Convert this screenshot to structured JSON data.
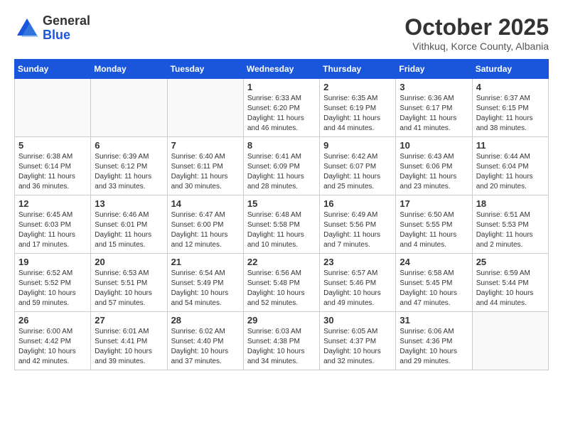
{
  "logo": {
    "general": "General",
    "blue": "Blue"
  },
  "title": "October 2025",
  "subtitle": "Vithkuq, Korce County, Albania",
  "headers": [
    "Sunday",
    "Monday",
    "Tuesday",
    "Wednesday",
    "Thursday",
    "Friday",
    "Saturday"
  ],
  "weeks": [
    [
      {
        "day": "",
        "info": ""
      },
      {
        "day": "",
        "info": ""
      },
      {
        "day": "",
        "info": ""
      },
      {
        "day": "1",
        "info": "Sunrise: 6:33 AM\nSunset: 6:20 PM\nDaylight: 11 hours\nand 46 minutes."
      },
      {
        "day": "2",
        "info": "Sunrise: 6:35 AM\nSunset: 6:19 PM\nDaylight: 11 hours\nand 44 minutes."
      },
      {
        "day": "3",
        "info": "Sunrise: 6:36 AM\nSunset: 6:17 PM\nDaylight: 11 hours\nand 41 minutes."
      },
      {
        "day": "4",
        "info": "Sunrise: 6:37 AM\nSunset: 6:15 PM\nDaylight: 11 hours\nand 38 minutes."
      }
    ],
    [
      {
        "day": "5",
        "info": "Sunrise: 6:38 AM\nSunset: 6:14 PM\nDaylight: 11 hours\nand 36 minutes."
      },
      {
        "day": "6",
        "info": "Sunrise: 6:39 AM\nSunset: 6:12 PM\nDaylight: 11 hours\nand 33 minutes."
      },
      {
        "day": "7",
        "info": "Sunrise: 6:40 AM\nSunset: 6:11 PM\nDaylight: 11 hours\nand 30 minutes."
      },
      {
        "day": "8",
        "info": "Sunrise: 6:41 AM\nSunset: 6:09 PM\nDaylight: 11 hours\nand 28 minutes."
      },
      {
        "day": "9",
        "info": "Sunrise: 6:42 AM\nSunset: 6:07 PM\nDaylight: 11 hours\nand 25 minutes."
      },
      {
        "day": "10",
        "info": "Sunrise: 6:43 AM\nSunset: 6:06 PM\nDaylight: 11 hours\nand 23 minutes."
      },
      {
        "day": "11",
        "info": "Sunrise: 6:44 AM\nSunset: 6:04 PM\nDaylight: 11 hours\nand 20 minutes."
      }
    ],
    [
      {
        "day": "12",
        "info": "Sunrise: 6:45 AM\nSunset: 6:03 PM\nDaylight: 11 hours\nand 17 minutes."
      },
      {
        "day": "13",
        "info": "Sunrise: 6:46 AM\nSunset: 6:01 PM\nDaylight: 11 hours\nand 15 minutes."
      },
      {
        "day": "14",
        "info": "Sunrise: 6:47 AM\nSunset: 6:00 PM\nDaylight: 11 hours\nand 12 minutes."
      },
      {
        "day": "15",
        "info": "Sunrise: 6:48 AM\nSunset: 5:58 PM\nDaylight: 11 hours\nand 10 minutes."
      },
      {
        "day": "16",
        "info": "Sunrise: 6:49 AM\nSunset: 5:56 PM\nDaylight: 11 hours\nand 7 minutes."
      },
      {
        "day": "17",
        "info": "Sunrise: 6:50 AM\nSunset: 5:55 PM\nDaylight: 11 hours\nand 4 minutes."
      },
      {
        "day": "18",
        "info": "Sunrise: 6:51 AM\nSunset: 5:53 PM\nDaylight: 11 hours\nand 2 minutes."
      }
    ],
    [
      {
        "day": "19",
        "info": "Sunrise: 6:52 AM\nSunset: 5:52 PM\nDaylight: 10 hours\nand 59 minutes."
      },
      {
        "day": "20",
        "info": "Sunrise: 6:53 AM\nSunset: 5:51 PM\nDaylight: 10 hours\nand 57 minutes."
      },
      {
        "day": "21",
        "info": "Sunrise: 6:54 AM\nSunset: 5:49 PM\nDaylight: 10 hours\nand 54 minutes."
      },
      {
        "day": "22",
        "info": "Sunrise: 6:56 AM\nSunset: 5:48 PM\nDaylight: 10 hours\nand 52 minutes."
      },
      {
        "day": "23",
        "info": "Sunrise: 6:57 AM\nSunset: 5:46 PM\nDaylight: 10 hours\nand 49 minutes."
      },
      {
        "day": "24",
        "info": "Sunrise: 6:58 AM\nSunset: 5:45 PM\nDaylight: 10 hours\nand 47 minutes."
      },
      {
        "day": "25",
        "info": "Sunrise: 6:59 AM\nSunset: 5:44 PM\nDaylight: 10 hours\nand 44 minutes."
      }
    ],
    [
      {
        "day": "26",
        "info": "Sunrise: 6:00 AM\nSunset: 4:42 PM\nDaylight: 10 hours\nand 42 minutes."
      },
      {
        "day": "27",
        "info": "Sunrise: 6:01 AM\nSunset: 4:41 PM\nDaylight: 10 hours\nand 39 minutes."
      },
      {
        "day": "28",
        "info": "Sunrise: 6:02 AM\nSunset: 4:40 PM\nDaylight: 10 hours\nand 37 minutes."
      },
      {
        "day": "29",
        "info": "Sunrise: 6:03 AM\nSunset: 4:38 PM\nDaylight: 10 hours\nand 34 minutes."
      },
      {
        "day": "30",
        "info": "Sunrise: 6:05 AM\nSunset: 4:37 PM\nDaylight: 10 hours\nand 32 minutes."
      },
      {
        "day": "31",
        "info": "Sunrise: 6:06 AM\nSunset: 4:36 PM\nDaylight: 10 hours\nand 29 minutes."
      },
      {
        "day": "",
        "info": ""
      }
    ]
  ]
}
